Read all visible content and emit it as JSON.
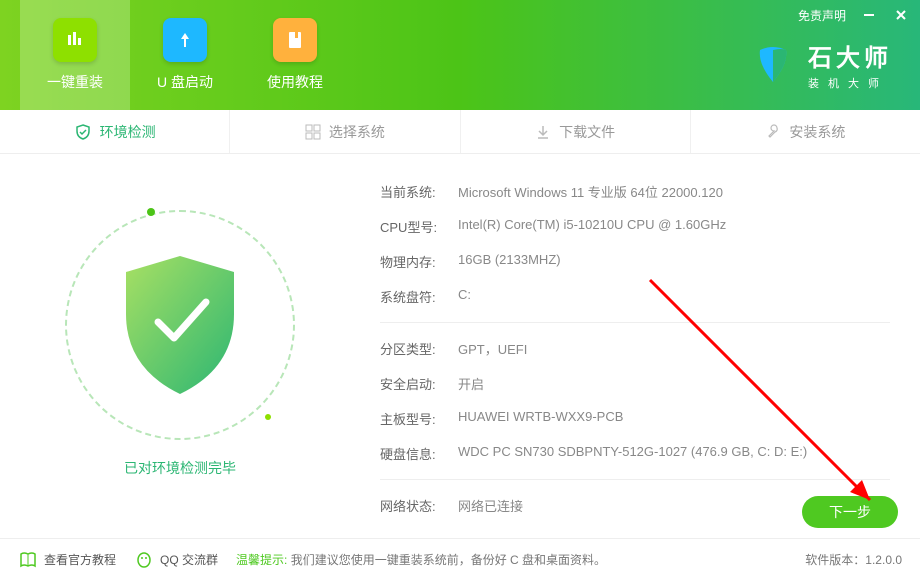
{
  "header": {
    "disclaimer": "免责声明",
    "tabs": [
      {
        "label": "一键重装"
      },
      {
        "label": "U 盘启动"
      },
      {
        "label": "使用教程"
      }
    ]
  },
  "brand": {
    "title": "石大师",
    "subtitle": "装机大师"
  },
  "steps": [
    {
      "label": "环境检测",
      "active": true
    },
    {
      "label": "选择系统",
      "active": false
    },
    {
      "label": "下载文件",
      "active": false
    },
    {
      "label": "安装系统",
      "active": false
    }
  ],
  "detect_done": "已对环境检测完毕",
  "info": {
    "os_label": "当前系统:",
    "os": "Microsoft Windows 11 专业版 64位 22000.120",
    "cpu_label": "CPU型号:",
    "cpu": "Intel(R) Core(TM) i5-10210U CPU @ 1.60GHz",
    "memory_label": "物理内存:",
    "memory": "16GB (2133MHZ)",
    "drive_label": "系统盘符:",
    "drive": "C:",
    "partition_label": "分区类型:",
    "partition": "GPT，UEFI",
    "secure_label": "安全启动:",
    "secure": "开启",
    "board_label": "主板型号:",
    "board": "HUAWEI WRTB-WXX9-PCB",
    "disk_label": "硬盘信息:",
    "disk": "WDC PC SN730 SDBPNTY-512G-1027   (476.9 GB, C: D: E:)",
    "net_label": "网络状态:",
    "net": "网络已连接"
  },
  "next": "下一步",
  "footer": {
    "tutorial": "查看官方教程",
    "qq": "QQ 交流群",
    "tip_label": "温馨提示:",
    "tip_text": "我们建议您使用一键重装系统前，备份好 C 盘和桌面资料。",
    "version_label": "软件版本：",
    "version": "1.2.0.0"
  }
}
